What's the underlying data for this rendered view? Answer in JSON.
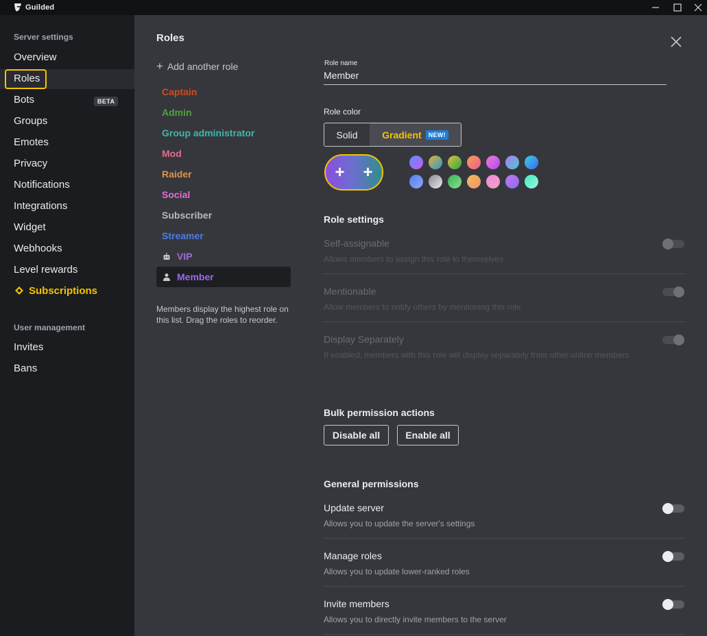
{
  "app": {
    "name": "Guilded"
  },
  "sidebar": {
    "server_heading": "Server settings",
    "items": [
      {
        "label": "Overview"
      },
      {
        "label": "Roles"
      },
      {
        "label": "Bots",
        "badge": "BETA"
      },
      {
        "label": "Groups"
      },
      {
        "label": "Emotes"
      },
      {
        "label": "Privacy"
      },
      {
        "label": "Notifications"
      },
      {
        "label": "Integrations"
      },
      {
        "label": "Widget"
      },
      {
        "label": "Webhooks"
      },
      {
        "label": "Level rewards"
      },
      {
        "label": "Subscriptions",
        "icon": "diamond-icon"
      }
    ],
    "user_heading": "User management",
    "user_items": [
      {
        "label": "Invites"
      },
      {
        "label": "Bans"
      }
    ]
  },
  "main": {
    "title": "Roles",
    "add_role": "Add another role",
    "roles": [
      {
        "label": "Captain",
        "color": "#d24a1c"
      },
      {
        "label": "Admin",
        "color": "#49a832"
      },
      {
        "label": "Group administrator",
        "color": "#3fb8a8"
      },
      {
        "label": "Mod",
        "color": "#e06e8a"
      },
      {
        "label": "Raider",
        "color": "#e2923f"
      },
      {
        "label": "Social",
        "color": "#e070d0"
      },
      {
        "label": "Subscriber",
        "color": "#b9bac0"
      },
      {
        "label": "Streamer",
        "color": "#4a7ce8"
      },
      {
        "label": "VIP",
        "color": "#a26ae0",
        "icon": "robot-icon"
      },
      {
        "label": "Member",
        "color": "#9a6ae8",
        "icon": "person-icon"
      }
    ],
    "roles_note": "Members display the highest role on this list. Drag the roles to reorder."
  },
  "editor": {
    "role_name_label": "Role name",
    "role_name_value": "Member",
    "role_color_label": "Role color",
    "solid_label": "Solid",
    "gradient_label": "Gradient",
    "new_badge": "NEW!",
    "plus": "+",
    "role_settings_title": "Role settings",
    "role_settings": [
      {
        "title": "Self-assignable",
        "desc": "Allows members to assign this role to themselves",
        "on": false
      },
      {
        "title": "Mentionable",
        "desc": "Allow members to notify others by mentioning this role",
        "on": true
      },
      {
        "title": "Display Separately",
        "desc": "If enabled, members with this role will display separately from other online members",
        "on": true
      }
    ],
    "bulk_title": "Bulk permission actions",
    "disable_all": "Disable all",
    "enable_all": "Enable all",
    "general_title": "General permissions",
    "general": [
      {
        "title": "Update server",
        "desc": "Allows you to update the server's settings",
        "on": false
      },
      {
        "title": "Manage roles",
        "desc": "Allows you to update lower-ranked roles",
        "on": false
      },
      {
        "title": "Invite members",
        "desc": "Allows you to directly invite members to the server",
        "on": false
      }
    ]
  },
  "colors": {
    "accent": "#f5c400",
    "sidebar_bg": "#1b1c20",
    "main_bg": "#36373d",
    "swatches_row1": [
      "linear-gradient(135deg,#5a8dfc,#c85af0)",
      "linear-gradient(135deg,#e0b23a,#2e9ad0)",
      "linear-gradient(135deg,#e0c23a,#2fa84a)",
      "linear-gradient(135deg,#f5a05a,#f05a8a)",
      "linear-gradient(135deg,#f07ad0,#b04af0)",
      "linear-gradient(135deg,#b07af0,#4ac8d0)",
      "linear-gradient(135deg,#3ad0e0,#3a6af0)"
    ],
    "swatches_row2": [
      "linear-gradient(135deg,#5a7af0,#8aaaf8)",
      "linear-gradient(135deg,#8a8a8e,#e8e8ec)",
      "linear-gradient(135deg,#3ab05a,#8ae08a)",
      "linear-gradient(135deg,#f0c05a,#f0906a)",
      "linear-gradient(135deg,#f08ae0,#f0a0c0)",
      "linear-gradient(135deg,#c07af0,#8a6af0)",
      "linear-gradient(135deg,#3af0c0,#a0f0e0)"
    ]
  }
}
